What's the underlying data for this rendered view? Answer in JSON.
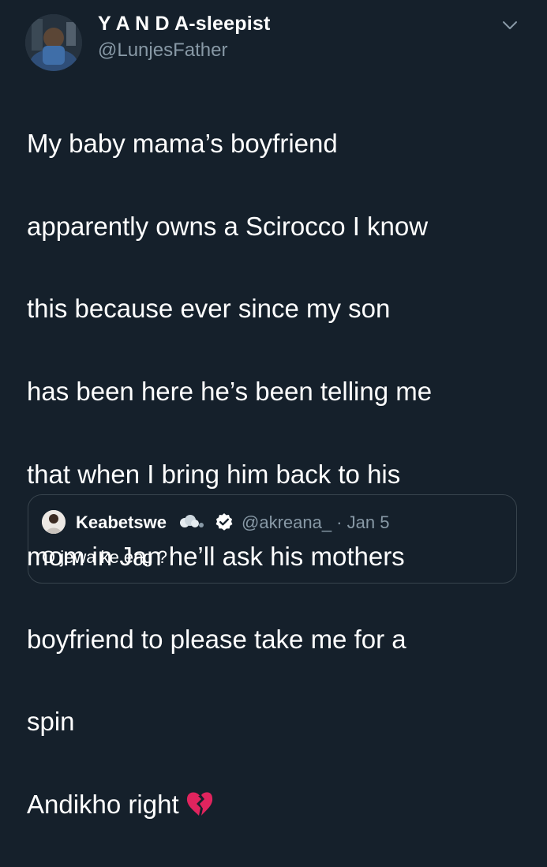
{
  "tweet": {
    "display_name": "Y A N D A-sleepist",
    "handle": "@LunjesFather",
    "text_lines": [
      "My baby mama’s boyfriend",
      "apparently owns a Scirocco I know",
      "this because ever since my son",
      "has been here he’s been telling me",
      "that when I bring him back to his",
      "mom in Jan he’ll ask his mothers",
      "boyfriend to please take me for a",
      "spin",
      "Andikho right"
    ],
    "emoji": "broken-heart-icon"
  },
  "quoted_tweet": {
    "display_name": "Keabetswe",
    "name_emoji": "cloud-emoji-icon",
    "verified": true,
    "meta": "@akreana_ · Jan 5",
    "text": "O jewa ke eng ?"
  },
  "colors": {
    "background": "#15202b",
    "secondary_text": "#8899a6",
    "border": "#38444d",
    "broken_heart": "#e0245e",
    "verified_badge": "#ffffff"
  }
}
